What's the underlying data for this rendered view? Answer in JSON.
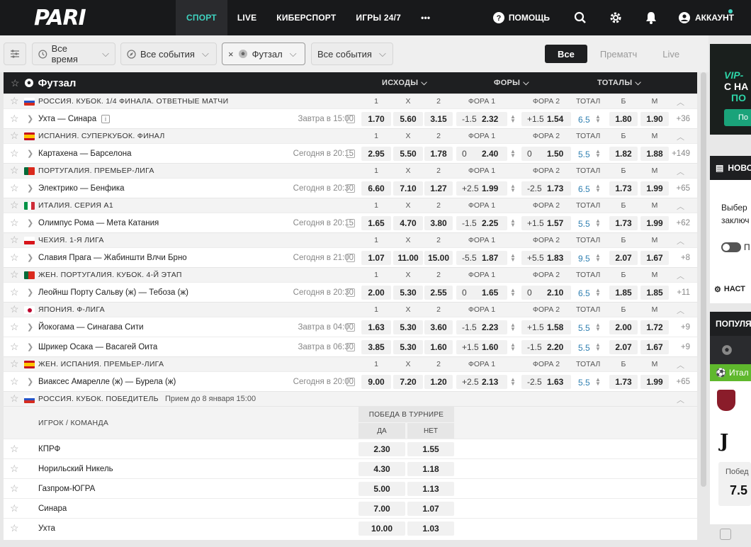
{
  "logo": "PARI",
  "nav": {
    "items": [
      "СПОРТ",
      "LIVE",
      "КИБЕРСПОРТ",
      "ИГРЫ 24/7",
      "•••"
    ],
    "help": "ПОМОЩЬ",
    "account": "АККАУНТ"
  },
  "filters": {
    "time": "Все время",
    "events": "Все события",
    "sport": "Футзал",
    "events2": "Все события"
  },
  "segments": [
    "Все",
    "Прематч",
    "Live"
  ],
  "sport": {
    "title": "Футзал",
    "cols": [
      "ИСХОДЫ",
      "ФОРЫ",
      "ТОТАЛЫ"
    ]
  },
  "league_headers": [
    "1",
    "X",
    "2",
    "ФОРА 1",
    "ФОРА 2",
    "ТОТАЛ",
    "Б",
    "М"
  ],
  "leagues": [
    {
      "name": "РОССИЯ. КУБОК. 1/4 ФИНАЛА. ОТВЕТНЫЕ МАТЧИ",
      "flag": "ru",
      "events": [
        {
          "teams": "Ухта — Синара",
          "info": "i",
          "time": "Завтра в 15:00",
          "o1": "1.70",
          "ox": "5.60",
          "o2": "3.15",
          "h1": "-1.5",
          "h1v": "2.32",
          "h2": "+1.5",
          "h2v": "1.54",
          "total": "6.5",
          "tb": "1.80",
          "tm": "1.90",
          "more": "+36"
        }
      ]
    },
    {
      "name": "ИСПАНИЯ. СУПЕРКУБОК. ФИНАЛ",
      "flag": "es",
      "events": [
        {
          "teams": "Картахена — Барселона",
          "time": "Сегодня в 20:15",
          "o1": "2.95",
          "ox": "5.50",
          "o2": "1.78",
          "h1": "0",
          "h1v": "2.40",
          "h2": "0",
          "h2v": "1.50",
          "total": "5.5",
          "tb": "1.82",
          "tm": "1.88",
          "more": "+149"
        }
      ]
    },
    {
      "name": "ПОРТУГАЛИЯ. ПРЕМЬЕР-ЛИГА",
      "flag": "pt",
      "events": [
        {
          "teams": "Электрико — Бенфика",
          "time": "Сегодня в 20:30",
          "o1": "6.60",
          "ox": "7.10",
          "o2": "1.27",
          "h1": "+2.5",
          "h1v": "1.99",
          "h2": "-2.5",
          "h2v": "1.73",
          "total": "6.5",
          "tb": "1.73",
          "tm": "1.99",
          "more": "+65"
        }
      ]
    },
    {
      "name": "ИТАЛИЯ. СЕРИЯ А1",
      "flag": "it",
      "events": [
        {
          "teams": "Олимпус Рома — Мета Катания",
          "time": "Сегодня в 20:15",
          "o1": "1.65",
          "ox": "4.70",
          "o2": "3.80",
          "h1": "-1.5",
          "h1v": "2.25",
          "h2": "+1.5",
          "h2v": "1.57",
          "total": "5.5",
          "tb": "1.73",
          "tm": "1.99",
          "more": "+62"
        }
      ]
    },
    {
      "name": "ЧЕХИЯ. 1-Я ЛИГА",
      "flag": "cz",
      "events": [
        {
          "teams": "Славия Прага — Жабиншти Влчи Брно",
          "time": "Сегодня в 21:00",
          "o1": "1.07",
          "ox": "11.00",
          "o2": "15.00",
          "h1": "-5.5",
          "h1v": "1.87",
          "h2": "+5.5",
          "h2v": "1.83",
          "total": "9.5",
          "tb": "2.07",
          "tm": "1.67",
          "more": "+8"
        }
      ]
    },
    {
      "name": "ЖЕН. ПОРТУГАЛИЯ. КУБОК. 4-Й ЭТАП",
      "flag": "pt",
      "events": [
        {
          "teams": "Леойнш Порту Сальву (ж) — Тебоза (ж)",
          "time": "Сегодня в 20:30",
          "o1": "2.00",
          "ox": "5.30",
          "o2": "2.55",
          "h1": "0",
          "h1v": "1.65",
          "h2": "0",
          "h2v": "2.10",
          "total": "6.5",
          "tb": "1.85",
          "tm": "1.85",
          "more": "+11"
        }
      ]
    },
    {
      "name": "ЯПОНИЯ. Ф-ЛИГА",
      "flag": "jp",
      "events": [
        {
          "teams": "Йокогама — Синагава Сити",
          "time": "Завтра в 04:00",
          "o1": "1.63",
          "ox": "5.30",
          "o2": "3.60",
          "h1": "-1.5",
          "h1v": "2.23",
          "h2": "+1.5",
          "h2v": "1.58",
          "total": "5.5",
          "tb": "2.00",
          "tm": "1.72",
          "more": "+9"
        },
        {
          "teams": "Шрикер Осака — Васагей Оита",
          "time": "Завтра в 06:30",
          "o1": "3.85",
          "ox": "5.30",
          "o2": "1.60",
          "h1": "+1.5",
          "h1v": "1.60",
          "h2": "-1.5",
          "h2v": "2.20",
          "total": "5.5",
          "tb": "2.07",
          "tm": "1.67",
          "more": "+9"
        }
      ]
    },
    {
      "name": "ЖЕН. ИСПАНИЯ. ПРЕМЬЕР-ЛИГА",
      "flag": "es",
      "events": [
        {
          "teams": "Виаксес Амарелле (ж) — Бурела (ж)",
          "time": "Сегодня в 20:00",
          "o1": "9.00",
          "ox": "7.20",
          "o2": "1.20",
          "h1": "+2.5",
          "h1v": "2.13",
          "h2": "-2.5",
          "h2v": "1.63",
          "total": "5.5",
          "tb": "1.73",
          "tm": "1.99",
          "more": "+65"
        }
      ]
    }
  ],
  "outright": {
    "name": "РОССИЯ. КУБОК. ПОБЕДИТЕЛЬ",
    "note": "Прием до 8 января 15:00",
    "col_label": "ИГРОК / КОМАНДА",
    "market": "ПОБЕДА В ТУРНИРЕ",
    "yes": "ДА",
    "no": "НЕТ",
    "rows": [
      {
        "name": "КПРФ",
        "yes": "2.30",
        "no": "1.55"
      },
      {
        "name": "Норильский Никель",
        "yes": "4.30",
        "no": "1.18"
      },
      {
        "name": "Газпром-ЮГРА",
        "yes": "5.00",
        "no": "1.13"
      },
      {
        "name": "Синара",
        "yes": "7.00",
        "no": "1.07"
      },
      {
        "name": "Ухта",
        "yes": "10.00",
        "no": "1.03"
      }
    ]
  },
  "sidebar": {
    "vip": "VIP-",
    "promo1": "С НА",
    "promo2": "ПО",
    "promo_btn": "По",
    "news": "НОВО",
    "news_text1": "Выбер",
    "news_text2": "заключ",
    "toggle": "П",
    "settings": "НАСТ",
    "popular": "ПОПУЛЯ",
    "popular_league": "Итал",
    "popular_label": "Побед",
    "popular_odd": "7.5"
  },
  "colors": {
    "accent": "#3fd3c0",
    "dark": "#1e1f21",
    "total": "#2f7fb1"
  }
}
